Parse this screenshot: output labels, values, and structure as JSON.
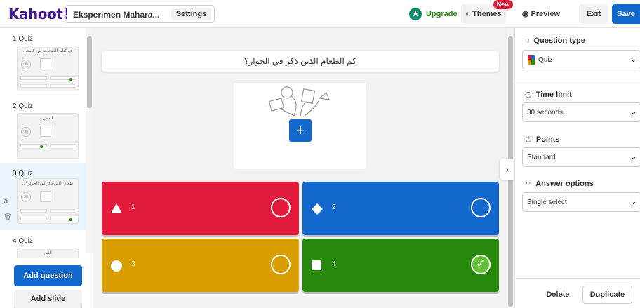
{
  "header": {
    "logo": "Kahoot!",
    "quiz_title": "Eksperimen Mahara...",
    "settings_label": "Settings",
    "upgrade_label": "Upgrade",
    "themes_label": "Themes",
    "themes_badge": "New",
    "preview_label": "Preview",
    "exit_label": "Exit",
    "save_label": "Save"
  },
  "sidebar": {
    "slides": [
      {
        "label": "1 Quiz",
        "question": "ف كتابة الصحيحة من كلمة..."
      },
      {
        "label": "2 Quiz",
        "question": "البيض"
      },
      {
        "label": "3 Quiz",
        "question": "طعام الذين ذكر في الحوار؟..."
      },
      {
        "label": "4 Quiz",
        "question": "الثين"
      }
    ],
    "thumb_timer": "30",
    "add_question_label": "Add question",
    "add_slide_label": "Add slide"
  },
  "editor": {
    "question_text": "كم الطعام الذين ذكر في الحوار؟",
    "answers": [
      {
        "num": "1",
        "color": "#e21b3c",
        "shape": "triangle",
        "correct": false
      },
      {
        "num": "2",
        "color": "#1368ce",
        "shape": "diamond",
        "correct": false
      },
      {
        "num": "3",
        "color": "#d89e00",
        "shape": "circle",
        "correct": false
      },
      {
        "num": "4",
        "color": "#26890c",
        "shape": "square",
        "correct": true
      }
    ]
  },
  "panel": {
    "question_type_title": "Question type",
    "question_type_value": "Quiz",
    "time_limit_title": "Time limit",
    "time_limit_value": "30 seconds",
    "points_title": "Points",
    "points_value": "Standard",
    "answer_options_title": "Answer options",
    "answer_options_value": "Single select",
    "delete_label": "Delete",
    "duplicate_label": "Duplicate"
  }
}
